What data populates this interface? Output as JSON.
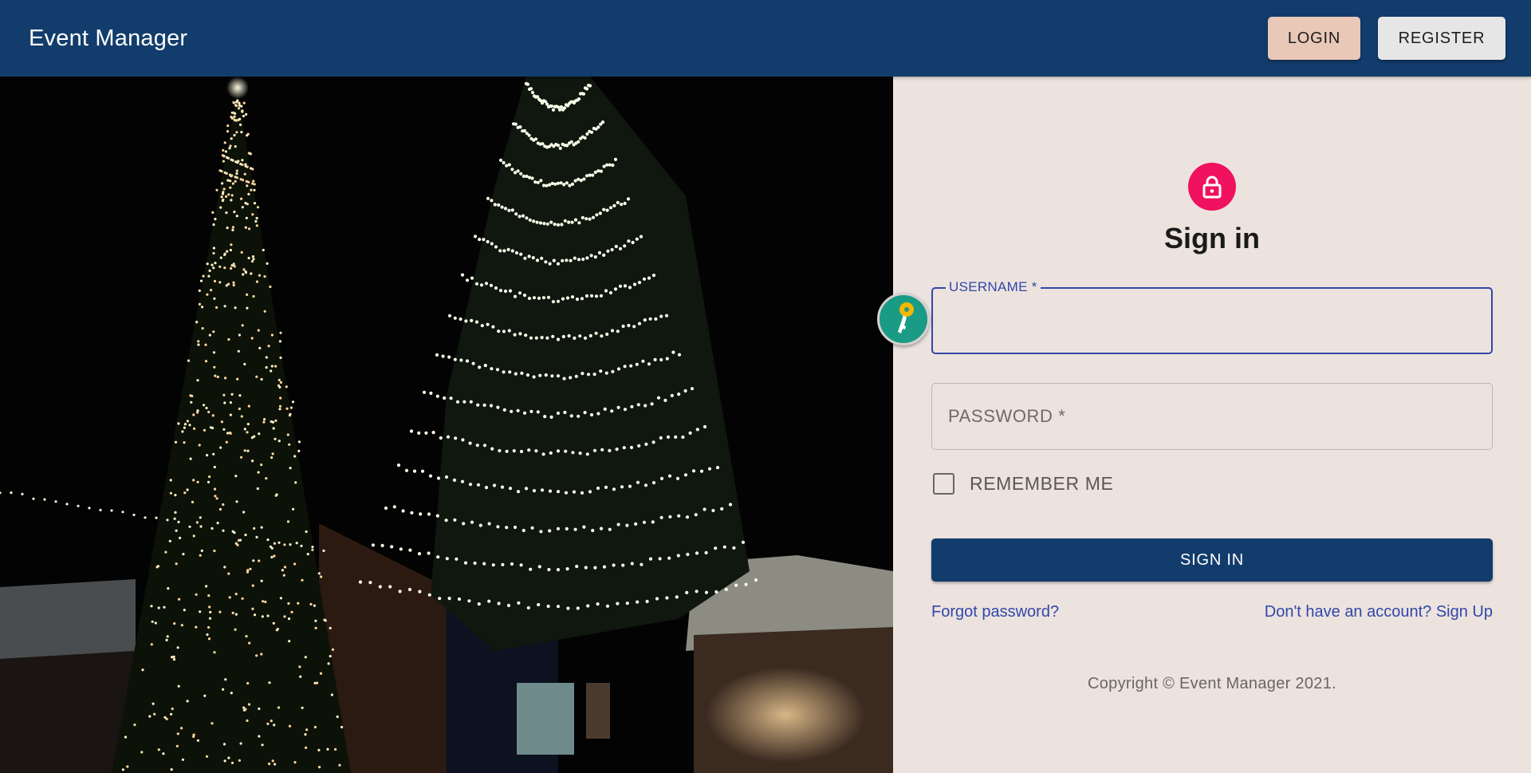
{
  "appbar": {
    "title": "Event Manager",
    "login_label": "LOGIN",
    "register_label": "REGISTER"
  },
  "hero": {
    "icon": "christmas-trees-photo"
  },
  "signin": {
    "title": "Sign in",
    "lock_icon": "lock-icon",
    "username": {
      "label": "USERNAME *",
      "value": "",
      "focused": true
    },
    "password": {
      "placeholder": "PASSWORD *",
      "value": ""
    },
    "remember_label": "REMEMBER ME",
    "remember_checked": false,
    "submit_label": "SIGN IN",
    "forgot_link": "Forgot password?",
    "signup_link": "Don't have an account? Sign Up",
    "copyright": "Copyright © Event Manager 2021."
  },
  "overlay": {
    "icon": "key-icon"
  },
  "colors": {
    "appbar": "#123c6c",
    "accent": "#3247a8",
    "lock_avatar": "#f0115f",
    "panel_bg": "#ece3df",
    "login_button": "#e9c8b8",
    "key_badge": "#1a9b86"
  }
}
